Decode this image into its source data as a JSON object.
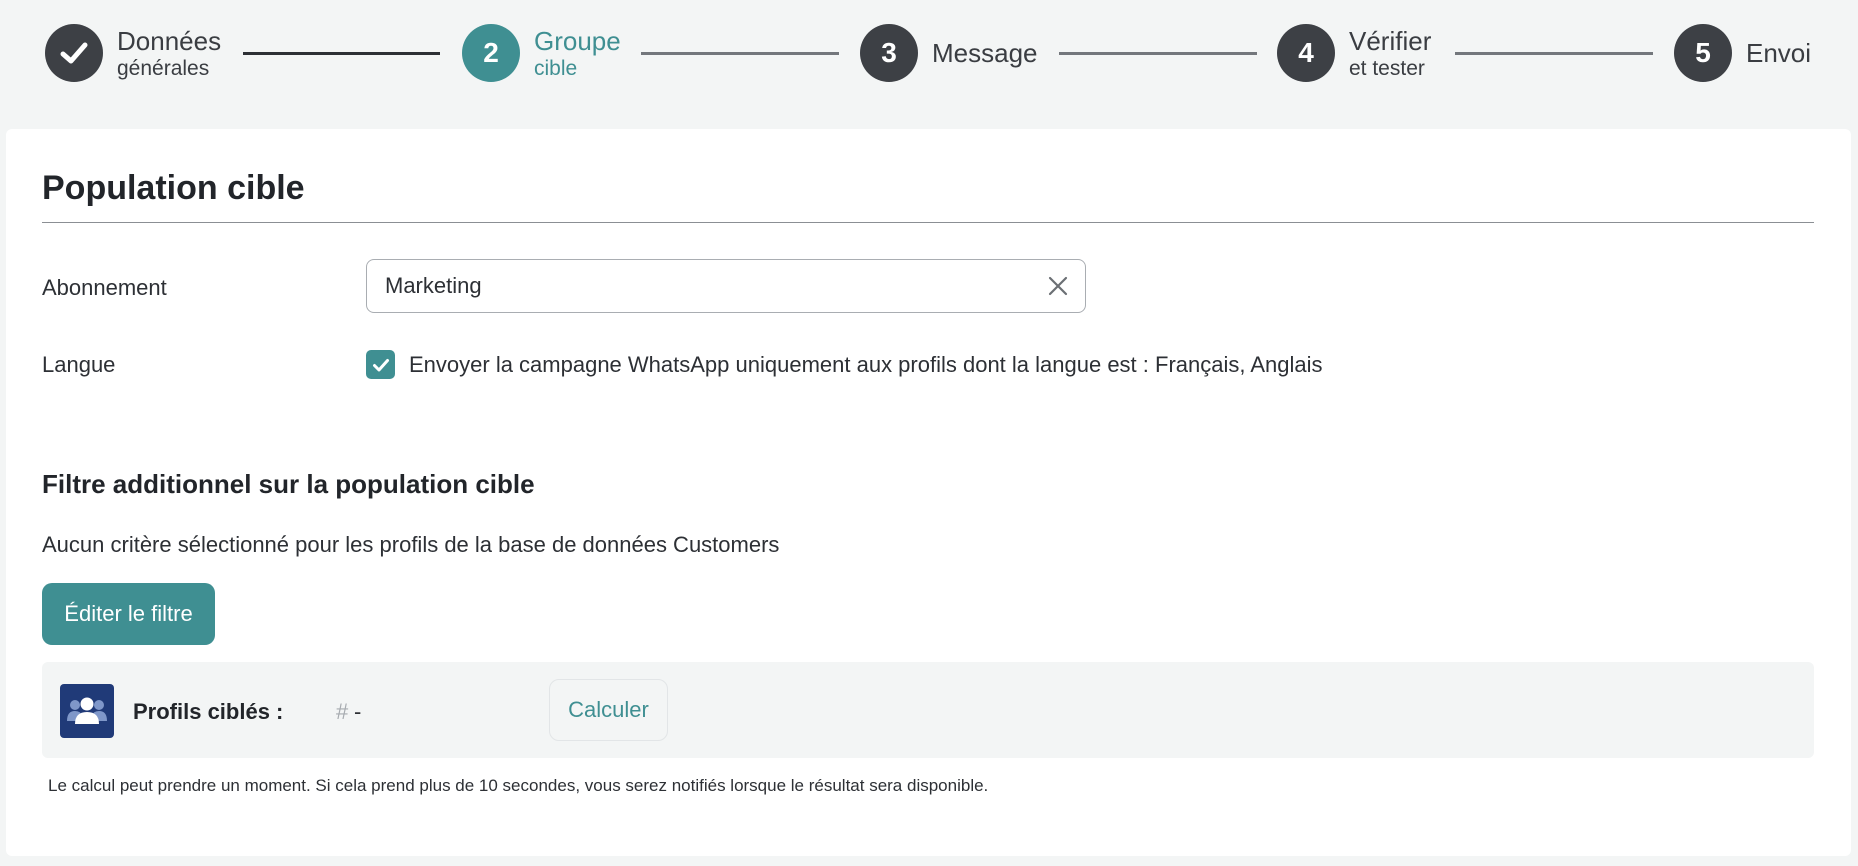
{
  "stepper": {
    "steps": [
      {
        "number": "",
        "title": "Données",
        "subtitle": "générales",
        "status": "done"
      },
      {
        "number": "2",
        "title": "Groupe",
        "subtitle": "cible",
        "status": "active"
      },
      {
        "number": "3",
        "title": "Message",
        "subtitle": "",
        "status": "todo"
      },
      {
        "number": "4",
        "title": "Vérifier",
        "subtitle": "et tester",
        "status": "todo"
      },
      {
        "number": "5",
        "title": "Envoi",
        "subtitle": "",
        "status": "todo"
      }
    ]
  },
  "main": {
    "title": "Population cible",
    "subscription": {
      "label": "Abonnement",
      "value": "Marketing",
      "clear_icon": "close-icon"
    },
    "language": {
      "label": "Langue",
      "checked": true,
      "checkbox_label": "Envoyer la campagne WhatsApp uniquement aux profils dont la langue est : Français, Anglais"
    }
  },
  "filter": {
    "title": "Filtre additionnel sur la population cible",
    "description": "Aucun critère sélectionné pour les profils de la base de données Customers",
    "edit_button": "Éditer le filtre"
  },
  "profiles": {
    "icon": "users-icon",
    "label": "Profils ciblés :",
    "hash": "#",
    "count": "-",
    "calculate_button": "Calculer",
    "note": "Le calcul peut prendre un moment. Si cela prend plus de 10 secondes, vous serez notifiés lorsque le résultat sera disponible."
  },
  "colors": {
    "accent": "#3f8f92",
    "step_dark": "#3d4045",
    "avatar_bg": "#203a78",
    "page_bg": "#f3f5f5"
  }
}
